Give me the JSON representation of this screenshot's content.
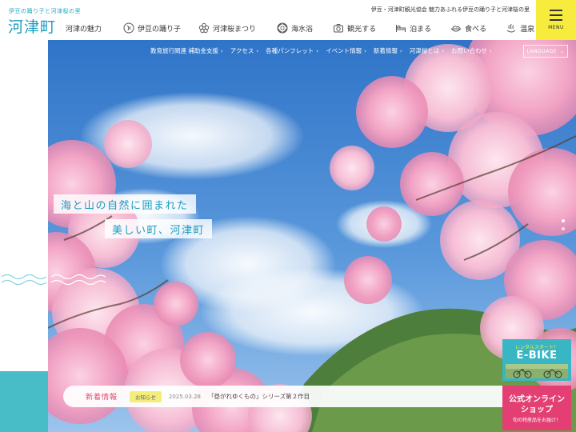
{
  "header": {
    "tagline": "伊豆の踊り子と河津桜の里",
    "logo": "河津町",
    "sub_text": "伊豆・河津町観光協会 魅力あふれる伊豆の踊り子と河津桜の里",
    "menu_label": "MENU"
  },
  "nav": [
    {
      "label": "河津の魅力",
      "icon": "sparkle-icon"
    },
    {
      "label": "伊豆の踊り子",
      "icon": "dancer-icon"
    },
    {
      "label": "河津桜まつり",
      "icon": "sakura-icon"
    },
    {
      "label": "海水浴",
      "icon": "swim-ring-icon"
    },
    {
      "label": "観光する",
      "icon": "camera-icon"
    },
    {
      "label": "泊まる",
      "icon": "bed-icon"
    },
    {
      "label": "食べる",
      "icon": "food-icon"
    },
    {
      "label": "温泉",
      "icon": "hot-spring-icon"
    }
  ],
  "subnav": [
    "教育旅行関連 補助金支援",
    "アクセス",
    "各種パンフレット",
    "イベント情報",
    "新着情報",
    "河津桜とは",
    "お問い合わせ"
  ],
  "language_label": "LANGUAGE",
  "hero": {
    "catch_line1": "海と山の自然に囲まれた",
    "catch_line2": "美しい町、河津町"
  },
  "news": {
    "label": "新着情報",
    "badge": "お知らせ",
    "date": "2025.03.28",
    "title": "「昼がれゆくもの」シリーズ第２作目"
  },
  "banners": {
    "ebike_sub": "レンタルスタート！",
    "ebike_main": "E-BIKE",
    "shop_line1": "公式オンライン",
    "shop_line2": "ショップ",
    "shop_line3": "旬の特産品をお届け！"
  },
  "colors": {
    "accent": "#1a9cc0",
    "menu": "#f7ec3e",
    "teal": "#48bcc7",
    "pink": "#e33f73"
  }
}
